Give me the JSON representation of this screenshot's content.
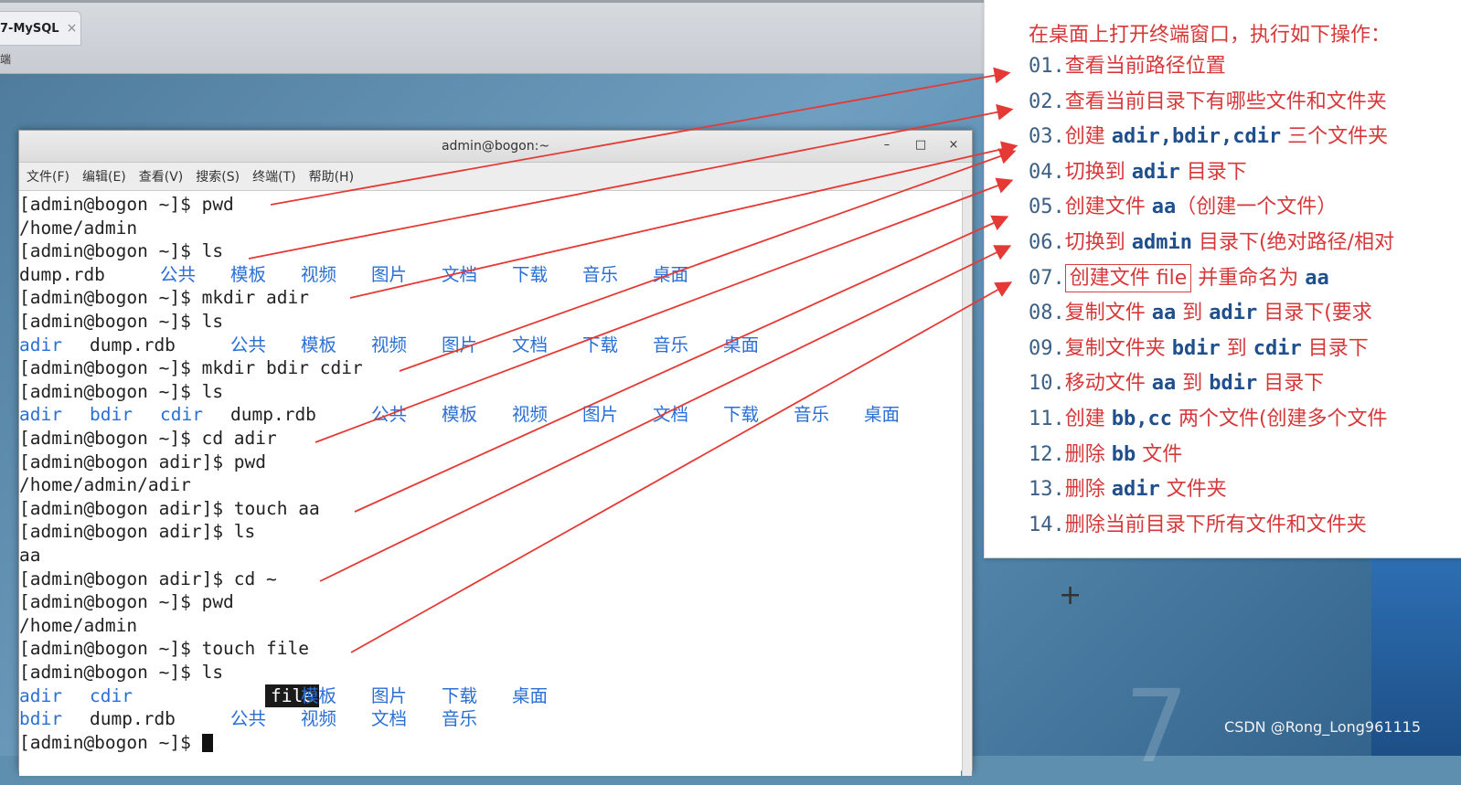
{
  "browser": {
    "tab_label": "7-MySQL",
    "tab_close": "×",
    "sub_label": "端"
  },
  "terminal": {
    "title": "admin@bogon:~",
    "controls": {
      "minimize": "–",
      "maximize": "□",
      "close": "×"
    },
    "menu": [
      "文件(F)",
      "编辑(E)",
      "查看(V)",
      "搜索(S)",
      "终端(T)",
      "帮助(H)"
    ],
    "lines": [
      "[admin@bogon ~]$ pwd",
      "/home/admin",
      "[admin@bogon ~]$ ls",
      "LS1",
      "[admin@bogon ~]$ mkdir adir",
      "[admin@bogon ~]$ ls",
      "LS2",
      "[admin@bogon ~]$ mkdir bdir cdir",
      "[admin@bogon ~]$ ls",
      "LS3",
      "[admin@bogon ~]$ cd adir",
      "[admin@bogon adir]$ pwd",
      "/home/admin/adir",
      "[admin@bogon adir]$ touch aa",
      "[admin@bogon adir]$ ls",
      "aa",
      "[admin@bogon adir]$ cd ~",
      "[admin@bogon ~]$ pwd",
      "/home/admin",
      "[admin@bogon ~]$ touch file",
      "[admin@bogon ~]$ ls",
      "LS4A",
      "LS4B",
      "[admin@bogon ~]$ "
    ],
    "ls1": [
      "dump.rdb",
      "公共",
      "模板",
      "视频",
      "图片",
      "文档",
      "下载",
      "音乐",
      "桌面"
    ],
    "ls2": [
      "adir",
      "dump.rdb",
      "公共",
      "模板",
      "视频",
      "图片",
      "文档",
      "下载",
      "音乐",
      "桌面"
    ],
    "ls3": [
      "adir",
      "bdir",
      "cdir",
      "dump.rdb",
      "公共",
      "模板",
      "视频",
      "图片",
      "文档",
      "下载",
      "音乐",
      "桌面"
    ],
    "ls4a": [
      "adir",
      "cdir",
      "file",
      "模板",
      "图片",
      "下载",
      "桌面"
    ],
    "ls4b": [
      "bdir",
      "dump.rdb",
      "公共",
      "视频",
      "文档",
      "音乐"
    ]
  },
  "card": {
    "header": "在桌面上打开终端窗口，执行如下操作：",
    "steps": [
      {
        "num": "01.",
        "parts": [
          [
            "zh",
            "查看当前路径位置"
          ]
        ]
      },
      {
        "num": "02.",
        "parts": [
          [
            "zh",
            "查看当前目录下有哪些文件和文件夹"
          ]
        ]
      },
      {
        "num": "03.",
        "parts": [
          [
            "zh",
            "创建 "
          ],
          [
            "kw",
            "adir,bdir,cdir"
          ],
          [
            "zh",
            " 三个文件夹"
          ]
        ]
      },
      {
        "num": "04.",
        "parts": [
          [
            "zh",
            "切换到 "
          ],
          [
            "kw",
            "adir"
          ],
          [
            "zh",
            " 目录下"
          ]
        ]
      },
      {
        "num": "05.",
        "parts": [
          [
            "zh",
            "创建文件 "
          ],
          [
            "kw",
            "aa"
          ],
          [
            "zh",
            "（创建一个文件）"
          ]
        ]
      },
      {
        "num": "06.",
        "parts": [
          [
            "zh",
            "切换到 "
          ],
          [
            "kw",
            "admin"
          ],
          [
            "zh",
            " 目录下(绝对路径/相对"
          ]
        ]
      },
      {
        "num": "07.",
        "parts": [
          [
            "box",
            "创建文件 file"
          ],
          [
            "zh",
            " 并重命名为 "
          ],
          [
            "kw",
            "aa"
          ]
        ]
      },
      {
        "num": "08.",
        "parts": [
          [
            "zh",
            "复制文件 "
          ],
          [
            "kw",
            "aa"
          ],
          [
            "zh",
            " 到 "
          ],
          [
            "kw",
            "adir"
          ],
          [
            "zh",
            " 目录下(要求"
          ]
        ]
      },
      {
        "num": "09.",
        "parts": [
          [
            "zh",
            "复制文件夹 "
          ],
          [
            "kw",
            "bdir"
          ],
          [
            "zh",
            " 到 "
          ],
          [
            "kw",
            "cdir"
          ],
          [
            "zh",
            " 目录下"
          ]
        ]
      },
      {
        "num": "10.",
        "parts": [
          [
            "zh",
            "移动文件 "
          ],
          [
            "kw",
            "aa"
          ],
          [
            "zh",
            " 到 "
          ],
          [
            "kw",
            "bdir"
          ],
          [
            "zh",
            " 目录下"
          ]
        ]
      },
      {
        "num": "11.",
        "parts": [
          [
            "zh",
            "创建 "
          ],
          [
            "kw",
            "bb,cc"
          ],
          [
            "zh",
            " 两个文件(创建多个文件"
          ]
        ]
      },
      {
        "num": "12.",
        "parts": [
          [
            "zh",
            "删除 "
          ],
          [
            "kw",
            "bb"
          ],
          [
            "zh",
            " 文件"
          ]
        ]
      },
      {
        "num": "13.",
        "parts": [
          [
            "zh",
            "删除 "
          ],
          [
            "kw",
            "adir"
          ],
          [
            "zh",
            " 文件夹"
          ]
        ]
      },
      {
        "num": "14.",
        "parts": [
          [
            "zh",
            "删除当前目录下所有文件和文件夹"
          ]
        ]
      }
    ]
  },
  "watermark": "CSDN @Rong_Long961115",
  "colors": {
    "arrow": "#e53935",
    "prompt_blue": "#2a6fd6",
    "card_red": "#d6383a"
  }
}
